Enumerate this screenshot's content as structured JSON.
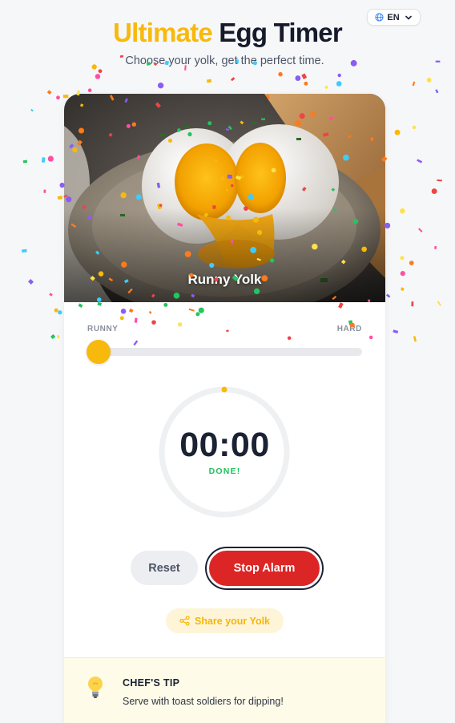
{
  "header": {
    "title_highlight": "Ultimate",
    "title_rest": "Egg Timer",
    "subtitle": "Choose your yolk, get the perfect time."
  },
  "language": {
    "selected": "EN",
    "icon": "globe-icon"
  },
  "hero": {
    "label": "Runny Yolk"
  },
  "slider": {
    "min_label": "RUNNY",
    "max_label": "HARD",
    "level": 0
  },
  "timer": {
    "display": "00:00",
    "status": "DONE!",
    "progress": 0
  },
  "actions": {
    "reset_label": "Reset",
    "stop_label": "Stop Alarm",
    "share_label": "Share your Yolk",
    "share_icon": "share-icon"
  },
  "tip": {
    "title": "CHEF'S TIP",
    "text": "Serve with toast soldiers for dipping!",
    "icon": "lightbulb-icon"
  },
  "colors": {
    "accent": "#f8b90d",
    "stop": "#dc2626",
    "done": "#21c15d",
    "text": "#1b2233"
  }
}
